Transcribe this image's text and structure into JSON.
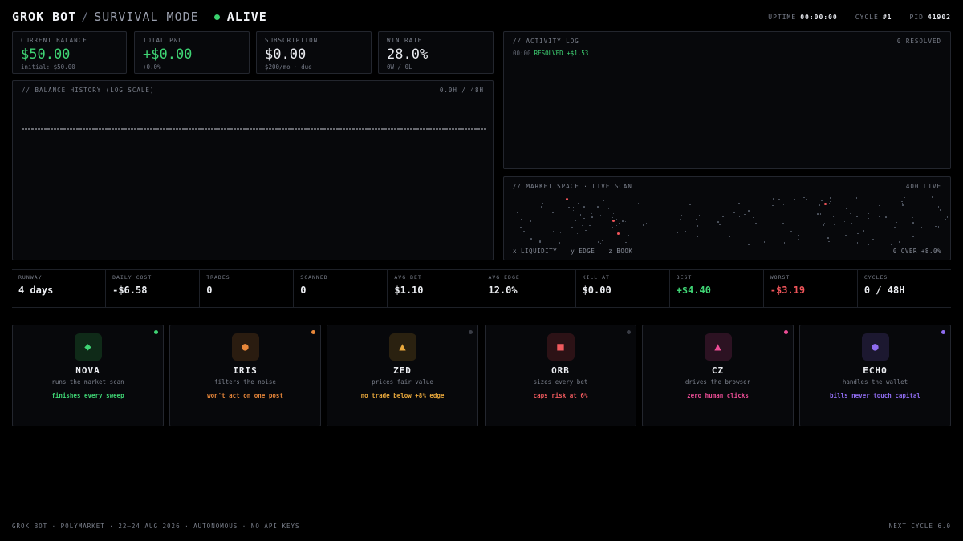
{
  "header": {
    "title": "GROK BOT",
    "separator": "/",
    "mode": "SURVIVAL MODE",
    "state": "ALIVE",
    "uptime_label": "UPTIME",
    "uptime_value": "00:00:00",
    "cycle_label": "CYCLE",
    "cycle_value": "#1",
    "pid_label": "PID",
    "pid_value": "41902",
    "status_color": "#3ad16e"
  },
  "stats": [
    {
      "label": "CURRENT BALANCE",
      "value": "$50.00",
      "sub": "initial: $50.00",
      "tone": "green"
    },
    {
      "label": "TOTAL P&L",
      "value": "+$0.00",
      "sub": "+0.0%",
      "tone": "green"
    },
    {
      "label": "SUBSCRIPTION",
      "value": "$0.00",
      "sub": "$200/mo · due",
      "tone": "neutral"
    },
    {
      "label": "WIN RATE",
      "value": "28.0%",
      "sub": "0W / 0L",
      "tone": "neutral"
    }
  ],
  "balance_history": {
    "title": "// BALANCE HISTORY (LOG SCALE)",
    "range": "0.0H / 48H"
  },
  "activity_log": {
    "title": "// ACTIVITY LOG",
    "resolved": "0 RESOLVED",
    "entries": [
      {
        "time": "00:00",
        "text": "RESOLVED +$1.53"
      }
    ]
  },
  "market": {
    "title": "// MARKET SPACE · LIVE SCAN",
    "live": "400 LIVE",
    "axis_x": "x LIQUIDITY",
    "axis_y": "y EDGE",
    "axis_z": "z BOOK",
    "over": "0 OVER +8.0%",
    "highlight_color": "#f0555a"
  },
  "metrics": [
    {
      "label": "RUNWAY",
      "value": "4 days",
      "tone": "neutral"
    },
    {
      "label": "DAILY COST",
      "value": "-$6.58",
      "tone": "neutral"
    },
    {
      "label": "TRADES",
      "value": "0",
      "tone": "neutral"
    },
    {
      "label": "SCANNED",
      "value": "0",
      "tone": "neutral"
    },
    {
      "label": "AVG BET",
      "value": "$1.10",
      "tone": "neutral"
    },
    {
      "label": "AVG EDGE",
      "value": "12.0%",
      "tone": "neutral"
    },
    {
      "label": "KILL AT",
      "value": "$0.00",
      "tone": "neutral"
    },
    {
      "label": "BEST",
      "value": "+$4.40",
      "tone": "green"
    },
    {
      "label": "WORST",
      "value": "-$3.19",
      "tone": "red"
    },
    {
      "label": "CYCLES",
      "value": "0 / 48H",
      "tone": "neutral"
    }
  ],
  "agents": [
    {
      "name": "NOVA",
      "role": "runs the market scan",
      "tag": "finishes every sweep",
      "icon": "diamond-icon",
      "glyph": "◆",
      "color": "#3fd474",
      "bg": "#0f2a18",
      "status_color": "#3fd474"
    },
    {
      "name": "IRIS",
      "role": "filters the noise",
      "tag": "won't act on one post",
      "icon": "circle-icon",
      "glyph": "●",
      "color": "#e8873a",
      "bg": "#2a1c10",
      "status_color": "#e8873a"
    },
    {
      "name": "ZED",
      "role": "prices fair value",
      "tag": "no trade below +8% edge",
      "icon": "triangle-icon",
      "glyph": "▲",
      "color": "#e9a83c",
      "bg": "#2a2110",
      "status_color": "#3a3d46"
    },
    {
      "name": "ORB",
      "role": "sizes every bet",
      "tag": "caps risk at 6%",
      "icon": "square-icon",
      "glyph": "■",
      "color": "#f05a5e",
      "bg": "#2c1216",
      "status_color": "#3a3d46"
    },
    {
      "name": "CZ",
      "role": "drives the browser",
      "tag": "zero human clicks",
      "icon": "triangle-icon",
      "glyph": "▲",
      "color": "#ee4d97",
      "bg": "#2c1222",
      "status_color": "#ee4d97"
    },
    {
      "name": "ECHO",
      "role": "handles the wallet",
      "tag": "bills never touch capital",
      "icon": "circle-icon",
      "glyph": "●",
      "color": "#8f6cf0",
      "bg": "#1c1830",
      "status_color": "#8f6cf0"
    }
  ],
  "footer": {
    "left": "GROK BOT · POLYMARKET · 22–24 AUG 2026 · AUTONOMOUS · NO API KEYS",
    "right": "NEXT CYCLE 6.0"
  }
}
